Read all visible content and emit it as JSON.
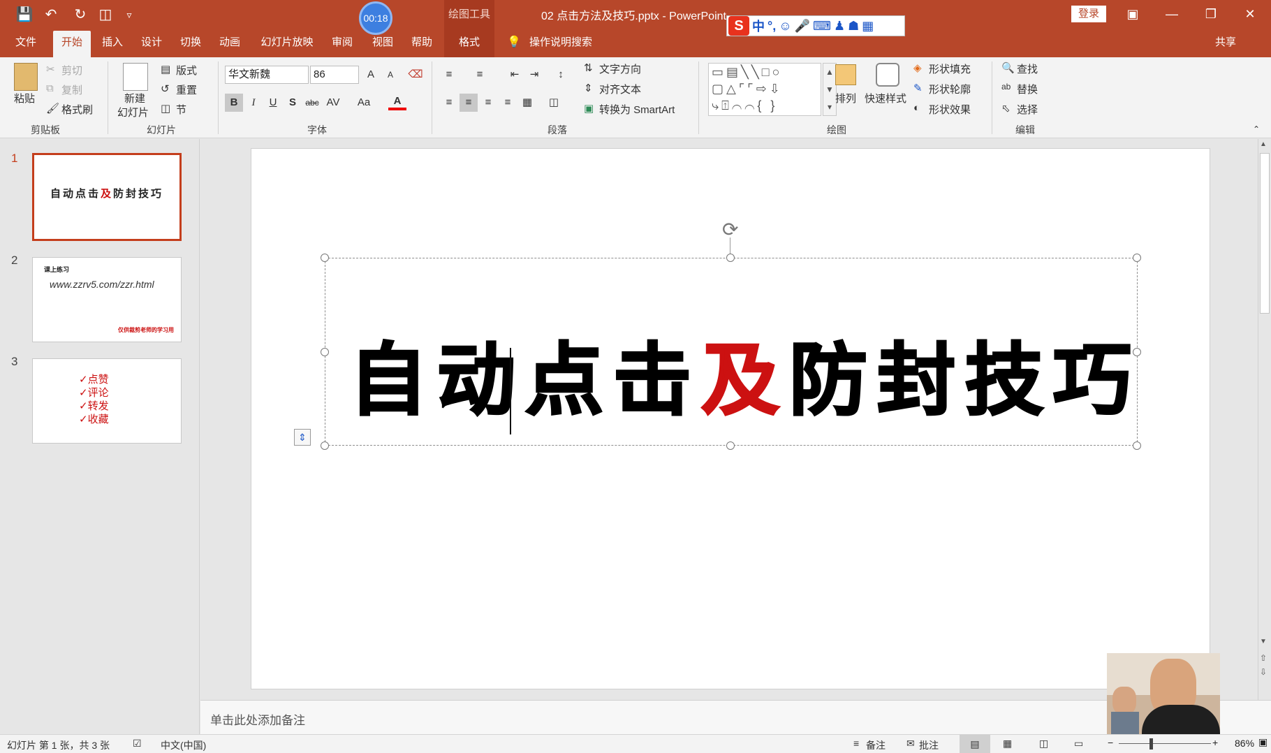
{
  "titlebar": {
    "timer": "00:18",
    "context_group": "绘图工具",
    "doc_title": "02 点击方法及技巧.pptx  -  PowerPoint",
    "login": "登录",
    "ime_s": "S",
    "ime_zh": "中",
    "ime_punct": "°,"
  },
  "tabs": [
    "文件",
    "开始",
    "插入",
    "设计",
    "切换",
    "动画",
    "幻灯片放映",
    "审阅",
    "视图",
    "帮助",
    "格式"
  ],
  "tell_me": "操作说明搜索",
  "share": "共享",
  "ribbon": {
    "clipboard": {
      "paste": "粘贴",
      "cut": "剪切",
      "copy": "复制",
      "painter": "格式刷",
      "label": "剪贴板"
    },
    "slides": {
      "new_slide": "新建",
      "new_slide2": "幻灯片",
      "layout": "版式",
      "reset": "重置",
      "section": "节",
      "label": "幻灯片"
    },
    "font": {
      "font_name": "华文新魏",
      "font_size": "86",
      "bold": "B",
      "italic": "I",
      "underline": "U",
      "shadow": "S",
      "strike": "abc",
      "spacing": "AV",
      "case": "Aa",
      "color": "A",
      "grow": "A",
      "shrink": "A",
      "label": "字体"
    },
    "paragraph": {
      "text_dir": "文字方向",
      "align_text": "对齐文本",
      "smartart": "转换为 SmartArt",
      "label": "段落"
    },
    "drawing": {
      "arrange": "排列",
      "quick_styles": "快速样式",
      "fill": "形状填充",
      "outline": "形状轮廓",
      "effect": "形状效果",
      "label": "绘图"
    },
    "editing": {
      "find": "查找",
      "replace": "替换",
      "select": "选择",
      "label": "编辑"
    }
  },
  "slides": [
    {
      "num": "1",
      "title": "自动点击",
      "red": "及",
      "title2": "防封技巧"
    },
    {
      "num": "2",
      "heading": "课上练习",
      "url": "www.zzrv5.com/zzr.html",
      "footer": "仅供裁剪老师的学习用"
    },
    {
      "num": "3",
      "items": [
        "✓点赞",
        "✓评论",
        "✓转发",
        "✓收藏"
      ]
    }
  ],
  "main": {
    "part1": "自动点击",
    "red": "及",
    "part2": "防封技巧"
  },
  "notes_placeholder": "单击此处添加备注",
  "status": {
    "slide_info": "幻灯片 第 1 张，共 3 张",
    "language": "中文(中国)",
    "notes": "备注",
    "comments": "批注",
    "zoom": "86%"
  },
  "colors": {
    "accent": "#b7472a",
    "red_text": "#cc1111"
  }
}
